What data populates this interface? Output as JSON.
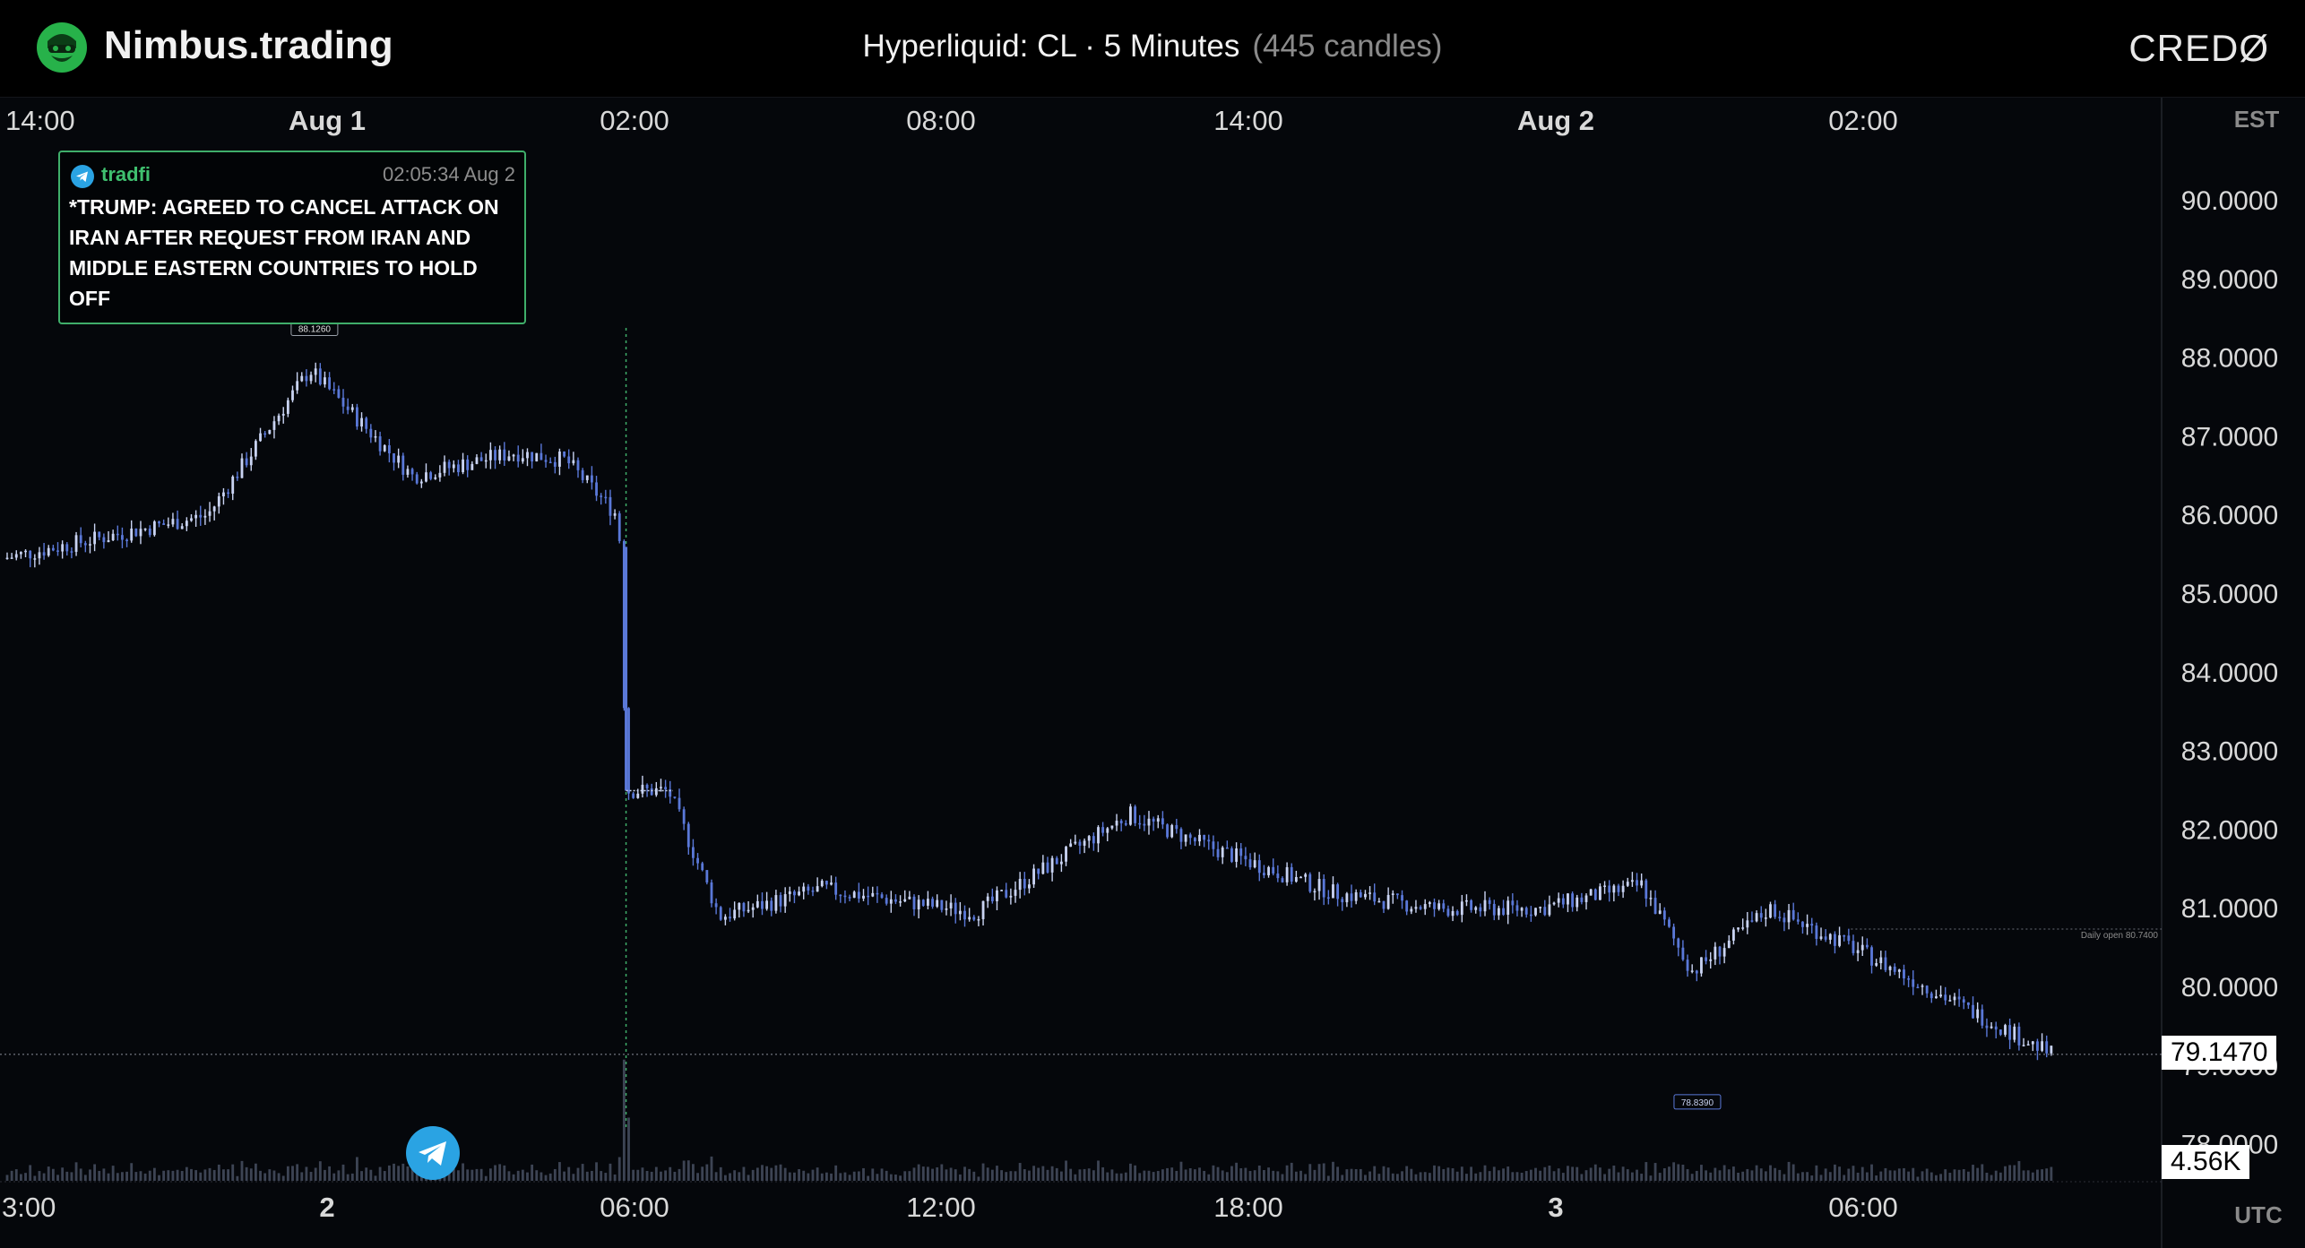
{
  "header": {
    "brand": "Nimbus.trading",
    "title_main": "Hyperliquid: CL · 5 Minutes",
    "title_count": "(445 candles)",
    "right_logo": "CREDØ"
  },
  "axes": {
    "top_tz": "EST",
    "bottom_tz": "UTC",
    "top_ticks": [
      "14:00",
      "Aug 1",
      "02:00",
      "08:00",
      "14:00",
      "Aug 2",
      "02:00"
    ],
    "top_bold": [
      "Aug 1",
      "Aug 2"
    ],
    "bottom_ticks": [
      "3:00",
      "2",
      "06:00",
      "12:00",
      "18:00",
      "3",
      "06:00"
    ],
    "bottom_bold": [
      "2",
      "3"
    ],
    "price_ticks": [
      "90.0000",
      "89.0000",
      "88.0000",
      "87.0000",
      "86.0000",
      "85.0000",
      "84.0000",
      "83.0000",
      "82.0000",
      "81.0000",
      "80.0000",
      "79.0000",
      "78.0000"
    ]
  },
  "news": {
    "source": "tradfi",
    "time": "02:05:34 Aug 2",
    "headline": "*TRUMP: AGREED TO CANCEL ATTACK ON IRAN AFTER REQUEST FROM IRAN AND MIDDLE EASTERN COUNTRIES TO HOLD OFF"
  },
  "labels": {
    "high_label": "88.1260",
    "low_label": "78.8390",
    "daily_open": "Daily open 80.7400",
    "last_price": "79.1470",
    "volume": "4.56K"
  },
  "colors": {
    "candle": "#5a78d8",
    "candle_light": "#c9d3f2",
    "news_accent": "#3fae6a",
    "telegram": "#2aa3e3"
  },
  "chart_data": {
    "type": "candlestick",
    "symbol": "CL",
    "venue": "Hyperliquid",
    "interval": "5 Minutes",
    "candles": 445,
    "y_range": [
      78.0,
      90.0
    ],
    "anchor_points": [
      {
        "x": "Jul 31 14:00",
        "y": 85.45
      },
      {
        "x": "Jul 31 18:00",
        "y": 86.0
      },
      {
        "x": "Jul 31 20:00",
        "y": 87.85
      },
      {
        "x": "Jul 31 22:00",
        "y": 86.5
      },
      {
        "x": "Aug 1 00:00",
        "y": 86.8
      },
      {
        "x": "Aug 1 01:00",
        "y": 86.7
      },
      {
        "x": "Aug 1 02:00",
        "y": 86.0
      },
      {
        "x": "Aug 1 02:05",
        "y": 85.45
      },
      {
        "x": "Aug 1 02:10",
        "y": 82.5
      },
      {
        "x": "Aug 1 03:00",
        "y": 82.5
      },
      {
        "x": "Aug 1 04:00",
        "y": 80.9
      },
      {
        "x": "Aug 1 06:00",
        "y": 81.25
      },
      {
        "x": "Aug 1 09:00",
        "y": 80.95
      },
      {
        "x": "Aug 1 12:00",
        "y": 82.2
      },
      {
        "x": "Aug 1 13:30",
        "y": 81.8
      },
      {
        "x": "Aug 1 16:00",
        "y": 81.2
      },
      {
        "x": "Aug 1 18:00",
        "y": 81.0
      },
      {
        "x": "Aug 1 20:00",
        "y": 81.0
      },
      {
        "x": "Aug 1 22:00",
        "y": 81.3
      },
      {
        "x": "Aug 1 23:00",
        "y": 80.2
      },
      {
        "x": "Aug 2 00:30",
        "y": 81.0
      },
      {
        "x": "Aug 2 02:00",
        "y": 80.55
      },
      {
        "x": "Aug 2 03:00",
        "y": 80.2
      },
      {
        "x": "Aug 2 06:00",
        "y": 79.15
      }
    ],
    "session_high": 88.126,
    "session_low": 78.839,
    "daily_open": 80.74,
    "last_price": 79.147
  }
}
